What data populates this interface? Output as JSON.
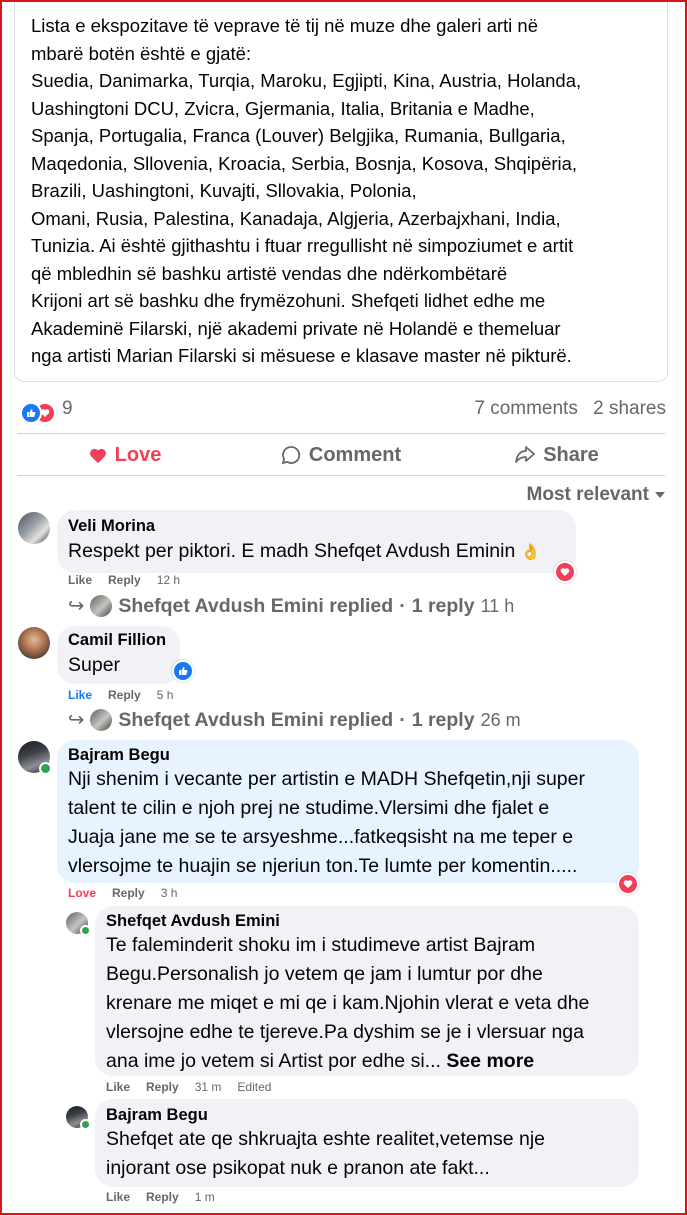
{
  "post": {
    "text": "Lista e ekspozitave të veprave të tij në muze dhe galeri arti në\nmbarë botën është e gjatë:\nSuedia, Danimarka, Turqia, Maroku, Egjipti, Kina, Austria, Holanda,\nUashingtoni DCU, Zvicra, Gjermania, Italia, Britania e Madhe,\nSpanja, Portugalia, Franca (Louver) Belgjika, Rumania, Bullgaria,\nMaqedonia, Sllovenia, Kroacia, Serbia, Bosnja, Kosova, Shqipëria,\nBrazili, Uashingtoni, Kuvajti, Sllovakia, Polonia,\nOmani, Rusia, Palestina, Kanadaja, Algjeria, Azerbajxhani, India,\nTunizia. Ai është gjithashtu i ftuar rregullisht në simpoziumet e artit\nqë mbledhin së bashku artistë vendas dhe ndërkombëtarë\nKrijoni art së bashku dhe frymëzohuni. Shefqeti lidhet edhe me\nAkademinë Filarski, një akademi private në Holandë e themeluar\nnga artisti Marian Filarski si mësuese e klasave master në pikturë."
  },
  "stats": {
    "reaction_count": "9",
    "comments": "7 comments",
    "shares": "2 shares"
  },
  "actions": {
    "love": "Love",
    "comment": "Comment",
    "share": "Share"
  },
  "sort": {
    "label": "Most relevant"
  },
  "comments": [
    {
      "name": "Veli Morina",
      "text": "Respekt per piktori. E madh Shefqet Avdush Eminin",
      "emoji": "👌",
      "like": "Like",
      "reply": "Reply",
      "time": "12 h",
      "reply_summary": {
        "text": "Shefqet Avdush Emini replied",
        "dot": "·",
        "count": "1 reply",
        "time": "11 h"
      }
    },
    {
      "name": "Camil Fillion",
      "text": "Super",
      "like": "Like",
      "reply": "Reply",
      "time": "5 h",
      "reply_summary": {
        "text": "Shefqet Avdush Emini replied",
        "dot": "·",
        "count": "1 reply",
        "time": "26 m"
      }
    },
    {
      "name": "Bajram Begu",
      "text_lines": [
        "Nji shenim i vecante per artistin e MADH Shefqetin,nji super",
        "talent te cilin e njoh prej ne studime.Vlersimi dhe fjalet e",
        "Juaja jane me se te arsyeshme...fatkeqsisht na me teper e",
        "vlersojme te huajin se njeriun ton.Te lumte per komentin....."
      ],
      "love": "Love",
      "reply": "Reply",
      "time": "3 h"
    }
  ],
  "replies": [
    {
      "name": "Shefqet Avdush Emini",
      "text_lines": [
        "Te faleminderit shoku im i studimeve artist Bajram",
        "Begu.Personalish jo vetem qe jam i lumtur por dhe",
        "krenare me miqet e mi qe i kam.Njohin vlerat e veta dhe",
        "vlersojne edhe te tjereve.Pa dyshim se je i vlersuar nga",
        "ana ime jo vetem si Artist por edhe si..."
      ],
      "see_more": "See more",
      "like": "Like",
      "reply": "Reply",
      "time": "31 m",
      "edited": "Edited"
    },
    {
      "name": "Bajram Begu",
      "text_lines": [
        "Shefqet ate qe shkruajta eshte realitet,vetemse nje",
        "injorant ose psikopat nuk e pranon ate fakt..."
      ],
      "like": "Like",
      "reply": "Reply",
      "time": "1 m"
    }
  ],
  "colors": {
    "love": "#f33e58",
    "like": "#1877f2",
    "bubble": "#f0f2f5",
    "bubble_highlight": "#e7f3ff",
    "frame": "#d9151c"
  }
}
